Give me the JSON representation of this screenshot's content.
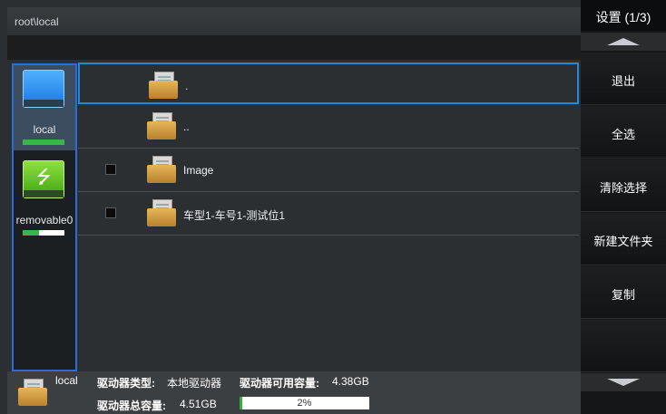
{
  "window": {
    "path": "root\\local"
  },
  "drives": [
    {
      "label": "local",
      "type": "hdd-icon",
      "usage_percent": 100,
      "selected": true
    },
    {
      "label": "removable0",
      "type": "usb-icon",
      "usage_percent": 40,
      "selected": false
    }
  ],
  "files": [
    {
      "name": ".",
      "checkbox": false,
      "focused": true
    },
    {
      "name": "..",
      "checkbox": false,
      "focused": false
    },
    {
      "name": "Image",
      "checkbox": true,
      "focused": false
    },
    {
      "name": "车型1-车号1-测试位1",
      "checkbox": true,
      "focused": false
    }
  ],
  "status": {
    "drive_name": "local",
    "type_label": "驱动器类型:",
    "type_value": "本地驱动器",
    "free_label": "驱动器可用容量:",
    "free_value": "4.38GB",
    "total_label": "驱动器总容量:",
    "total_value": "4.51GB",
    "usage_text": "2%",
    "usage_percent": 2
  },
  "menu": {
    "title": "设置 (1/3)",
    "buttons": [
      "退出",
      "全选",
      "清除选择",
      "新建文件夹",
      "复制",
      ""
    ]
  },
  "colors": {
    "focus_border": "#1e8ad8",
    "drive_panel_border": "#2f6bd6",
    "usage_green": "#2fb240"
  }
}
